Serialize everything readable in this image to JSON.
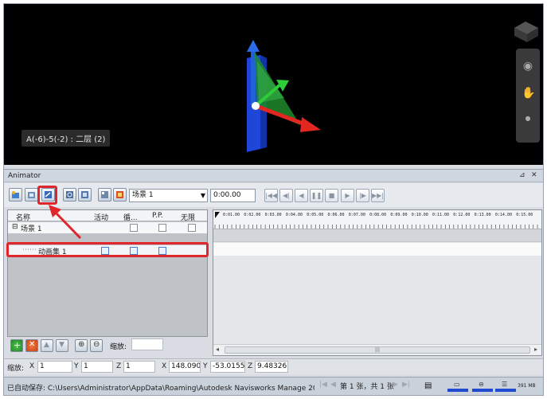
{
  "viewport": {
    "label": "A(-6)-5(-2) : 二层 (2)"
  },
  "animator": {
    "title": "Animator",
    "header_icons": [
      "pin-icon",
      "close-icon"
    ]
  },
  "toolbar": {
    "scene_select": "场景 1",
    "time": "0:00.00"
  },
  "tree": {
    "columns": [
      "名称",
      "活动",
      "循...",
      "P.P.",
      "无限"
    ],
    "rows": [
      {
        "name": "场景 1",
        "prefix": "⊟"
      },
      {
        "name": "动画集 1",
        "prefix": "⋯⋯"
      }
    ],
    "zoom_label": "缩放:",
    "zoom_value": ""
  },
  "timeline": {
    "ticks": [
      "0:01.00",
      "0:02.00",
      "0:03.00",
      "0:04.00",
      "0:05.00",
      "0:06.00",
      "0:07.00",
      "0:08.00",
      "0:09.00",
      "0:10.00",
      "0:11.00",
      "0:12.00",
      "0:13.00",
      "0:14.00",
      "0:15.00"
    ]
  },
  "scale_row": {
    "label": "缩放:",
    "x_label": "X",
    "x_value": "1",
    "y_label": "Y",
    "y_value": "1",
    "z_label": "Z",
    "z_value": "1",
    "px_label": "X",
    "px_value": "148.0904",
    "py_label": "Y",
    "py_value": "-53.0155",
    "pz_label": "Z",
    "pz_value": "9.483267"
  },
  "status": {
    "text": "已自动保存: C:\\Users\\Administrator\\AppData\\Roaming\\Autodesk Navisworks Manage 2019\\...",
    "page": "第 1 张，共 1 张",
    "memory": "391 MB"
  },
  "colors": {
    "highlight": "#e0262b",
    "axis_x": "#e3261f",
    "axis_y": "#2fcc3a",
    "axis_z": "#2060d8",
    "column": "#1f46d8"
  }
}
